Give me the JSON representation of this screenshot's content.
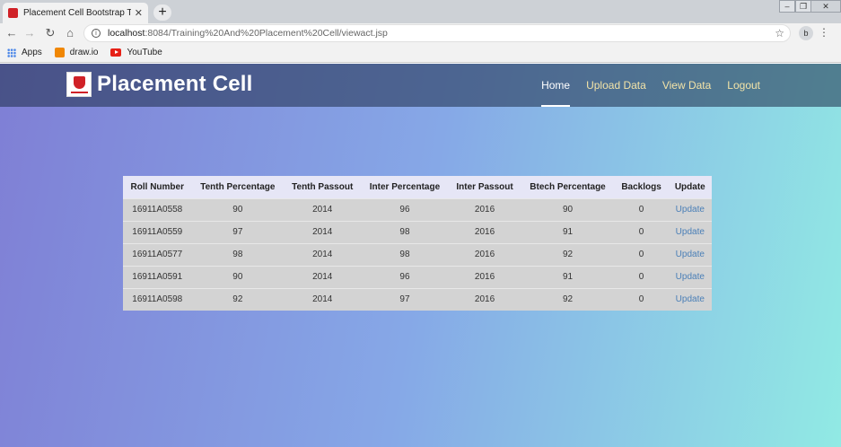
{
  "browser": {
    "tab_title": "Placement Cell Bootstrap Template",
    "tab_close": "✕",
    "new_tab": "+",
    "url_host": "localhost",
    "url_path": ":8084/Training%20And%20Placement%20Cell/viewact.jsp",
    "profile_initial": "b",
    "bookmarks": [
      {
        "label": "Apps",
        "icon": "apps-icon"
      },
      {
        "label": "draw.io",
        "icon": "drawio-icon"
      },
      {
        "label": "YouTube",
        "icon": "youtube-icon"
      }
    ]
  },
  "site": {
    "brand": "Placement Cell",
    "nav": [
      "Home",
      "Upload Data",
      "View Data",
      "Logout"
    ],
    "active_nav": "Home"
  },
  "table": {
    "headers": [
      "Roll Number",
      "Tenth Percentage",
      "Tenth Passout",
      "Inter Percentage",
      "Inter Passout",
      "Btech Percentage",
      "Backlogs",
      "Update"
    ],
    "rows": [
      [
        "16911A0558",
        "90",
        "2014",
        "96",
        "2016",
        "90",
        "0",
        "Update"
      ],
      [
        "16911A0559",
        "97",
        "2014",
        "98",
        "2016",
        "91",
        "0",
        "Update"
      ],
      [
        "16911A0577",
        "98",
        "2014",
        "98",
        "2016",
        "92",
        "0",
        "Update"
      ],
      [
        "16911A0591",
        "90",
        "2014",
        "96",
        "2016",
        "91",
        "0",
        "Update"
      ],
      [
        "16911A0598",
        "92",
        "2014",
        "97",
        "2016",
        "92",
        "0",
        "Update"
      ]
    ]
  },
  "colors": {
    "gradient_start": "#7f7fd5",
    "gradient_mid": "#86a8e7",
    "gradient_end": "#91eae4",
    "nav_link": "#f3e4a8",
    "update_link": "#4a7fb7"
  }
}
